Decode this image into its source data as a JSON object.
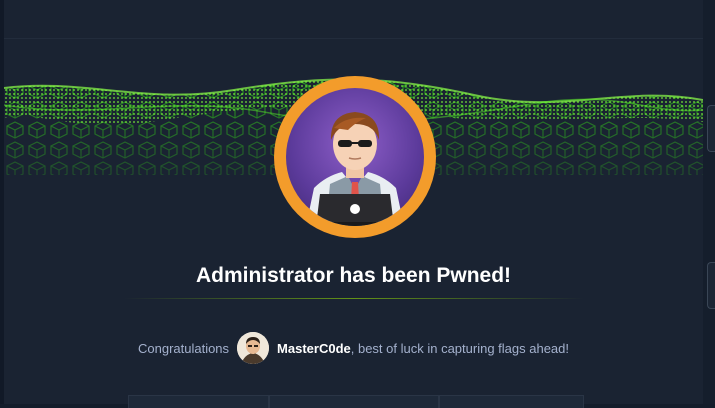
{
  "modal": {
    "title": "Administrator has been Pwned!",
    "message_prefix": "Congratulations",
    "username": "MasterC0de",
    "message_suffix": ", best of luck in capturing flags ahead!"
  },
  "colors": {
    "background": "#141d2b",
    "modal_bg": "#1a2332",
    "accent_green": "#9fef00",
    "avatar_ring": "#f39c2b",
    "avatar_bg": "#6a45a8",
    "muted_text": "#a4b1cd",
    "title_text": "#ffffff"
  },
  "icons": {
    "machine_avatar": "hacker-with-laptop-avatar",
    "user_avatar": "user-avatar"
  }
}
